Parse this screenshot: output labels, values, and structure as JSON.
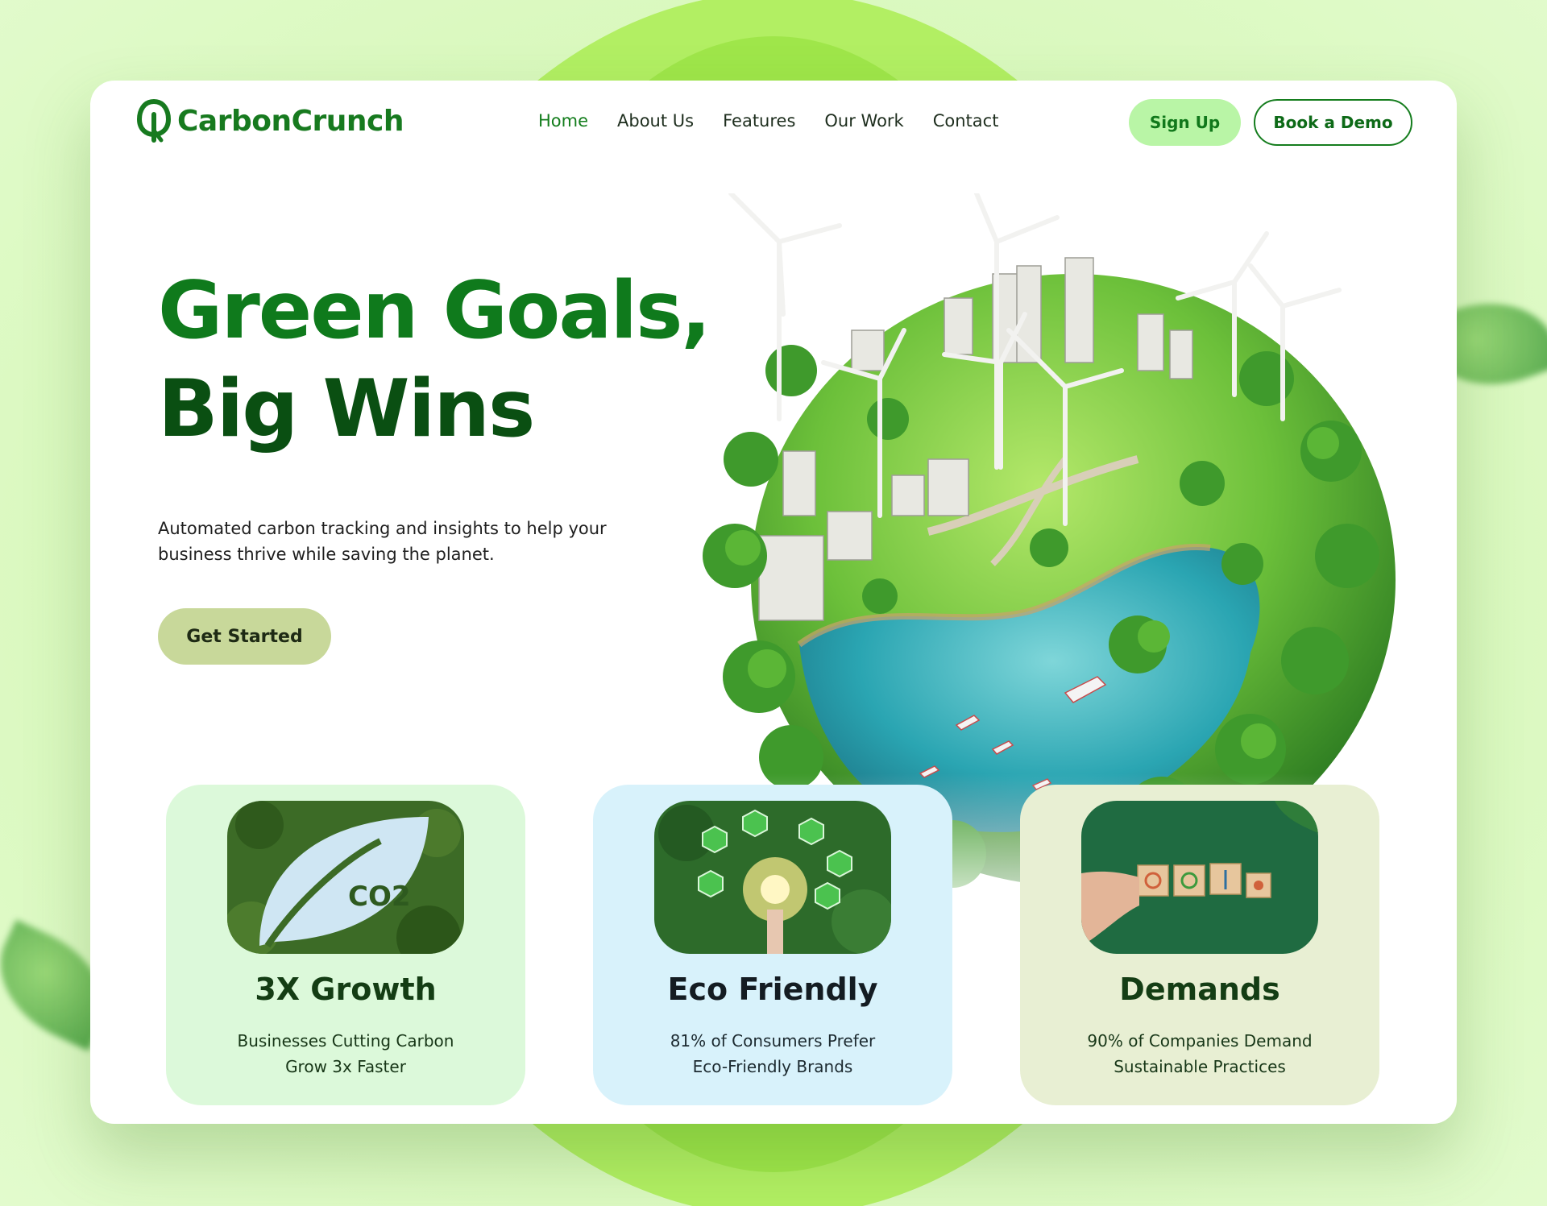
{
  "brand": {
    "name": "CarbonCrunch",
    "color": "#177a1f"
  },
  "nav": {
    "items": [
      {
        "label": "Home",
        "active": true
      },
      {
        "label": "About Us",
        "active": false
      },
      {
        "label": "Features",
        "active": false
      },
      {
        "label": "Our Work",
        "active": false
      },
      {
        "label": "Contact",
        "active": false
      }
    ]
  },
  "actions": {
    "signup": "Sign Up",
    "demo": "Book a Demo"
  },
  "hero": {
    "title_line1": "Green Goals,",
    "title_line2": "Big Wins",
    "subtitle": "Automated carbon tracking and insights to help your business thrive while saving the planet.",
    "cta": "Get Started",
    "image": "eco-globe-illustration"
  },
  "features": [
    {
      "title": "3X Growth",
      "desc_line1": "Businesses Cutting Carbon",
      "desc_line2": "Grow 3x Faster",
      "image": "co2-leaf-forest-image",
      "image_text": "CO2"
    },
    {
      "title": "Eco Friendly",
      "desc_line1": "81% of Consumers Prefer",
      "desc_line2": "Eco-Friendly Brands",
      "image": "lightbulb-eco-icons-image"
    },
    {
      "title": "Demands",
      "desc_line1": "90% of Companies Demand",
      "desc_line2": "Sustainable Practices",
      "image": "wooden-blocks-sustainability-image"
    }
  ],
  "colors": {
    "background": "#d6f7b4",
    "accent_green": "#0f7a1c",
    "dark_green": "#0a4f12",
    "signup_bg": "#b9f5a6",
    "cta_bg": "#c8d89a",
    "card1_bg": "#dcf9da",
    "card2_bg": "#d8f2fb",
    "card3_bg": "#e8efd3"
  }
}
